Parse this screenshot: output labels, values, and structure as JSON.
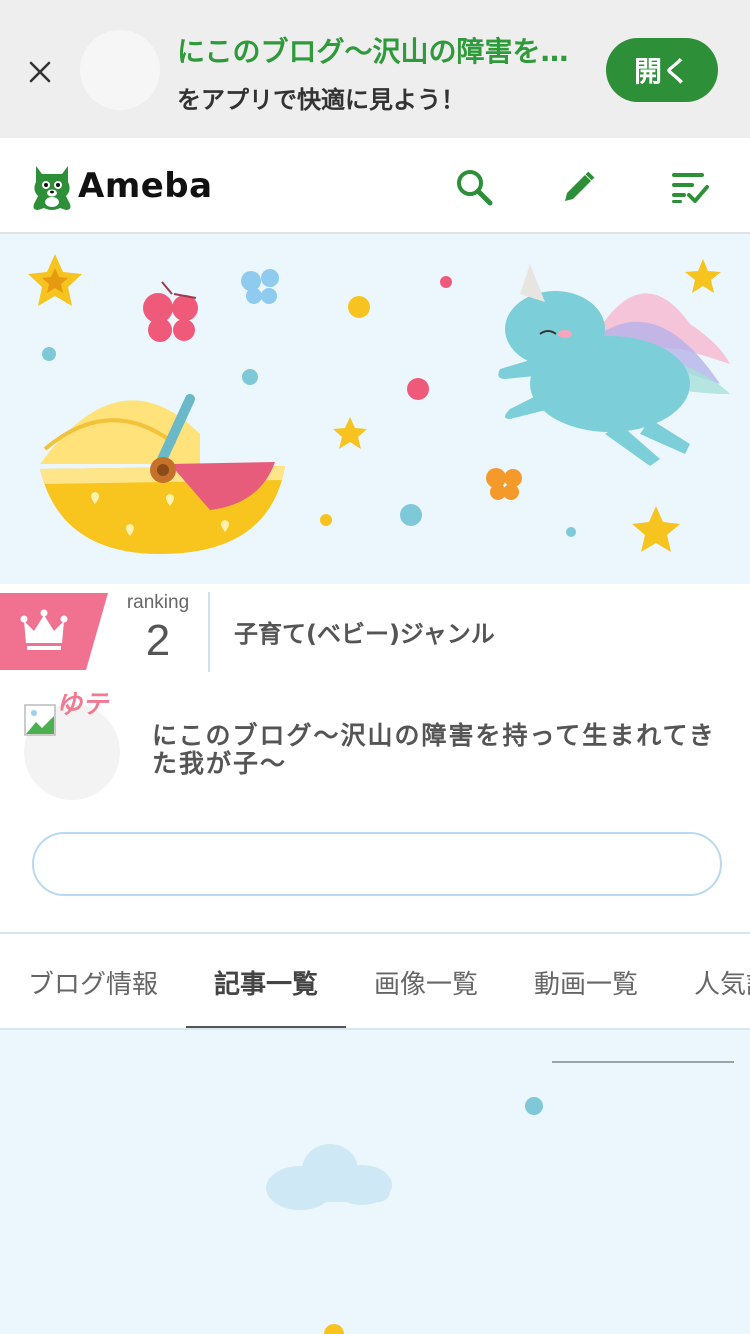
{
  "app_banner": {
    "title": "にこのブログ～沢山の障害を…",
    "subtitle": "をアプリで快適に見よう！",
    "open_label": "開く"
  },
  "header": {
    "logo_text": "Ameba",
    "icons": [
      "search-icon",
      "pencil-icon",
      "checklist-icon"
    ]
  },
  "ranking": {
    "label": "ranking",
    "number": "2",
    "genre": "子育て(ベビー)ジャンル"
  },
  "profile": {
    "name_overlay": "ゆテ",
    "blog_title": "にこのブログ～沢山の障害を持って生まれてきた我が子～"
  },
  "tabs": [
    {
      "label": "ブログ情報",
      "active": false
    },
    {
      "label": "記事一覧",
      "active": true
    },
    {
      "label": "画像一覧",
      "active": false
    },
    {
      "label": "動画一覧",
      "active": false
    },
    {
      "label": "人気記事",
      "active": false
    }
  ],
  "colors": {
    "brand_green": "#2d8f38",
    "banner_title_green": "#2f9a3a",
    "hero_bg": "#ecf7fd",
    "ranking_pink": "#f07290"
  }
}
